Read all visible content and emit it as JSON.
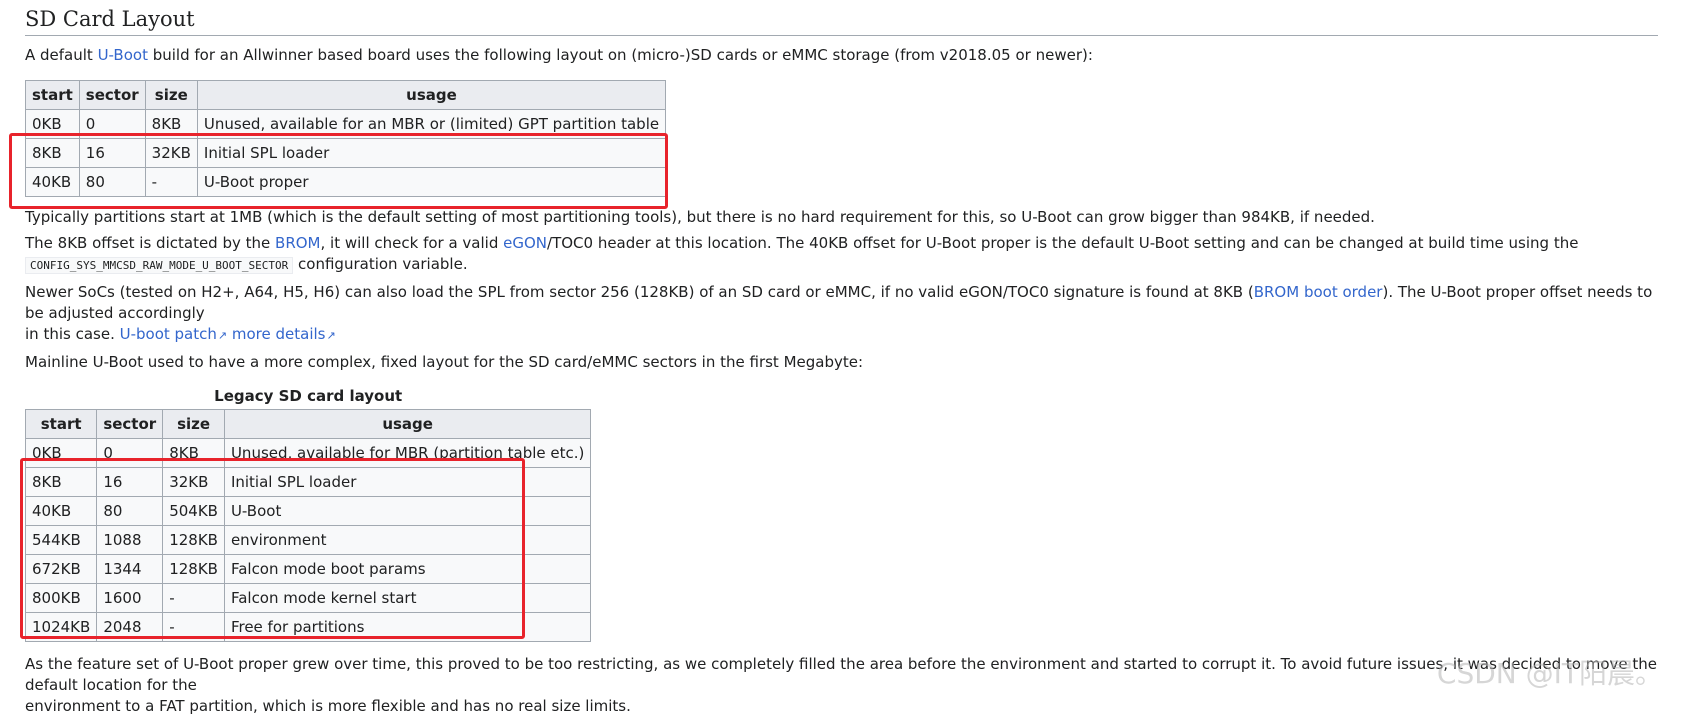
{
  "heading": "SD Card Layout",
  "intro": {
    "before": "A default ",
    "link": "U-Boot",
    "after": " build for an Allwinner based board uses the following layout on (micro-)SD cards or eMMC storage (from v2018.05 or newer):"
  },
  "table1": {
    "headers": [
      "start",
      "sector",
      "size",
      "usage"
    ],
    "rows": [
      [
        "0KB",
        "0",
        "8KB",
        "Unused, available for an MBR or (limited) GPT partition table"
      ],
      [
        "8KB",
        "16",
        "32KB",
        "Initial SPL loader"
      ],
      [
        "40KB",
        "80",
        "-",
        "U-Boot proper"
      ]
    ]
  },
  "para_typical": "Typically partitions start at 1MB (which is the default setting of most partitioning tools), but there is no hard requirement for this, so U-Boot can grow bigger than 984KB, if needed.",
  "para_offset": {
    "t1": "The 8KB offset is dictated by the ",
    "link1": "BROM",
    "t2": ", it will check for a valid ",
    "link2": "eGON",
    "t3": "/TOC0 header at this location. The 40KB offset for U-Boot proper is the default U-Boot setting and can be changed at build time using the",
    "code": "CONFIG_SYS_MMCSD_RAW_MODE_U_BOOT_SECTOR",
    "t4": " configuration variable."
  },
  "para_newer": {
    "t1": "Newer SoCs (tested on H2+, A64, H5, H6) can also load the SPL from sector 256 (128KB) of an SD card or eMMC, if no valid eGON/TOC0 signature is found at 8KB (",
    "link1": "BROM boot order",
    "t2": "). The U-Boot proper offset needs to be adjusted accordingly",
    "t3": "in this case. ",
    "link2": "U-boot patch",
    "link3": "more details"
  },
  "para_mainline": "Mainline U-Boot used to have a more complex, fixed layout for the SD card/eMMC sectors in the first Megabyte:",
  "table2": {
    "caption": "Legacy SD card layout",
    "headers": [
      "start",
      "sector",
      "size",
      "usage"
    ],
    "rows": [
      [
        "0KB",
        "0",
        "8KB",
        "Unused, available for MBR (partition table etc.)"
      ],
      [
        "8KB",
        "16",
        "32KB",
        "Initial SPL loader"
      ],
      [
        "40KB",
        "80",
        "504KB",
        "U-Boot"
      ],
      [
        "544KB",
        "1088",
        "128KB",
        "environment"
      ],
      [
        "672KB",
        "1344",
        "128KB",
        "Falcon mode boot params"
      ],
      [
        "800KB",
        "1600",
        "-",
        "Falcon mode kernel start"
      ],
      [
        "1024KB",
        "2048",
        "-",
        "Free for partitions"
      ]
    ]
  },
  "para_feature": {
    "line1": "As the feature set of U-Boot proper grew over time, this proved to be too restricting, as we completely filled the area before the environment and started to corrupt it. To avoid future issues, it was decided to move the default location for the",
    "line2": "environment to a FAT partition, which is more flexible and has no real size limits."
  },
  "watermark": "CSDN @IT阳晨。",
  "colors": {
    "link": "#3366cc",
    "highlight": "#e8232b",
    "table_bg": "#f8f9fa",
    "header_bg": "#eaecf0"
  }
}
